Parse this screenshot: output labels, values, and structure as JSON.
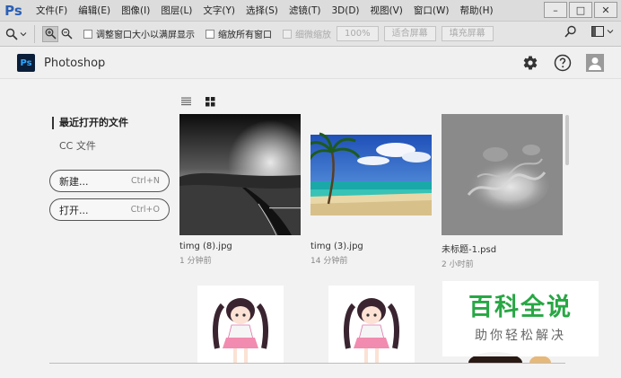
{
  "app": {
    "logo": "Ps",
    "name": "Photoshop"
  },
  "menu": [
    "文件(F)",
    "编辑(E)",
    "图像(I)",
    "图层(L)",
    "文字(Y)",
    "选择(S)",
    "滤镜(T)",
    "3D(D)",
    "视图(V)",
    "窗口(W)",
    "帮助(H)"
  ],
  "window_controls": {
    "minimize": "–",
    "maximize": "□",
    "close": "✕"
  },
  "options": {
    "resize_window": "调整窗口大小以满屏显示",
    "zoom_all": "缩放所有窗口",
    "scrubby_zoom": "细微缩放",
    "zoom_100": "100%",
    "fit_screen": "适合屏幕",
    "fill_screen": "填充屏幕"
  },
  "nav": {
    "recent": "最近打开的文件",
    "cc_files": "CC 文件"
  },
  "actions": {
    "new_label": "新建...",
    "new_shortcut": "Ctrl+N",
    "open_label": "打开...",
    "open_shortcut": "Ctrl+O"
  },
  "files": [
    {
      "name": "timg (8).jpg",
      "time": "1 分钟前"
    },
    {
      "name": "timg (3).jpg",
      "time": "14 分钟前"
    },
    {
      "name": "未标题-1.psd",
      "time": "2 小时前"
    }
  ],
  "watermark": {
    "main": "百科全说",
    "sub": "助你轻松解决"
  },
  "colors": {
    "ps_blue": "#31a8ff",
    "ps_dark": "#0a1e3a",
    "watermark_green": "#28a744"
  }
}
